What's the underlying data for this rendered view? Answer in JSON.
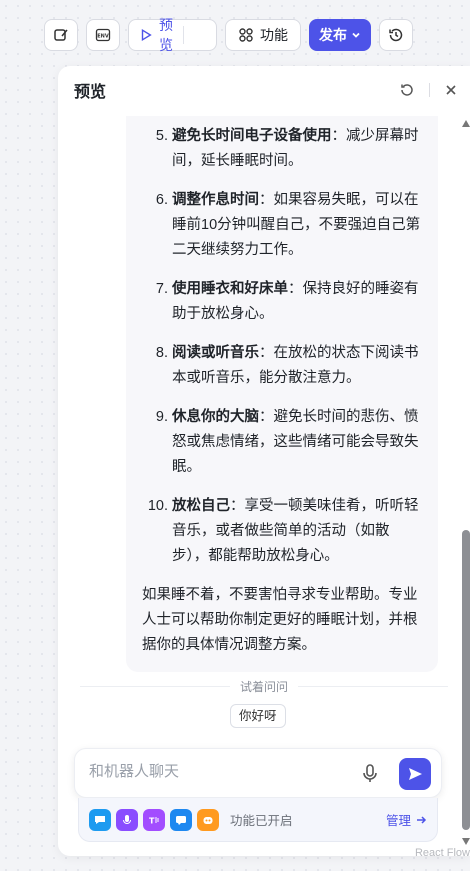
{
  "toolbar": {
    "preview_label": "预览",
    "feature_label": "功能",
    "publish_label": "发布"
  },
  "panel": {
    "title": "预览"
  },
  "message": {
    "items": [
      {
        "num": "5.",
        "title": "避免长时间电子设备使用",
        "text": "：减少屏幕时间，延长睡眠时间。"
      },
      {
        "num": "6.",
        "title": "调整作息时间",
        "text": "：如果容易失眠，可以在睡前10分钟叫醒自己，不要强迫自己第二天继续努力工作。"
      },
      {
        "num": "7.",
        "title": "使用睡衣和好床单",
        "text": "：保持良好的睡姿有助于放松身心。"
      },
      {
        "num": "8.",
        "title": "阅读或听音乐",
        "text": "：在放松的状态下阅读书本或听音乐，能分散注意力。"
      },
      {
        "num": "9.",
        "title": "休息你的大脑",
        "text": "：避免长时间的悲伤、愤怒或焦虑情绪，这些情绪可能会导致失眠。"
      },
      {
        "num": "10.",
        "title": "放松自己",
        "text": "：享受一顿美味佳肴，听听轻音乐，或者做些简单的活动（如散步），都能帮助放松身心。"
      }
    ],
    "closing": "如果睡不着，不要害怕寻求专业帮助。专业人士可以帮助你制定更好的睡眠计划，并根据你的具体情况调整方案。"
  },
  "try_ask": {
    "label": "试着问问",
    "suggestion": "你好呀"
  },
  "input": {
    "placeholder": "和机器人聊天"
  },
  "plugins": {
    "status": "功能已开启",
    "manage_label": "管理",
    "colors": [
      "#1e9bf0",
      "#8a4dff",
      "#a24dff",
      "#1e88f0",
      "#ff9a1f"
    ]
  },
  "watermark": "React Flow"
}
